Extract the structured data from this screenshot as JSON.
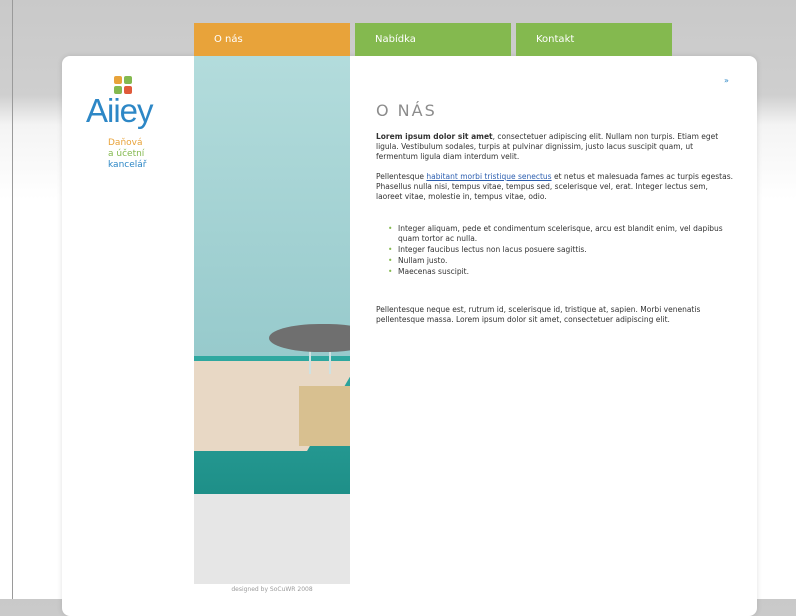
{
  "nav": {
    "about": "O nás",
    "offer": "Nabídka",
    "contact": "Kontakt"
  },
  "logo": {
    "word": "Aiiey",
    "tagline": [
      "Daňová",
      "a účetní",
      "kancelář"
    ],
    "dot_colors": [
      "#e8a33a",
      "#84b94f",
      "#2d87c6",
      "#e05a3a"
    ]
  },
  "colors": {
    "accent_orange": "#e8a33a",
    "accent_green": "#84b94f",
    "accent_blue": "#2d87c6"
  },
  "top_link": "»",
  "main": {
    "heading": "O NÁS",
    "p1_bold": "Lorem ipsum dolor sit amet",
    "p1_rest": ", consectetuer adipiscing elit. Nullam non turpis. Etiam eget ligula. Vestibulum sodales, turpis at pulvinar dignissim, justo lacus suscipit quam, ut fermentum ligula diam interdum velit.",
    "p2_start": "Pellentesque ",
    "p2_link": "habitant morbi tristique senectus",
    "p2_end": " et netus et malesuada fames ac turpis egestas. Phasellus nulla nisi, tempus vitae, tempus sed, scelerisque vel, erat. Integer lectus sem, laoreet vitae, molestie in, tempus vitae, odio.",
    "list": [
      "Integer aliquam, pede et condimentum scelerisque, arcu est blandit enim, vel dapibus quam tortor ac nulla.",
      "Integer faucibus lectus non lacus posuere sagittis.",
      "Nullam justo.",
      "Maecenas suscipit."
    ],
    "p3": "Pellentesque neque est, rutrum id, scelerisque id, tristique at, sapien. Morbi venenatis pellentesque massa. Lorem ipsum dolor sit amet, consectetuer adipiscing elit."
  },
  "footer": {
    "credits": "designed by SoCuWR 2008"
  }
}
